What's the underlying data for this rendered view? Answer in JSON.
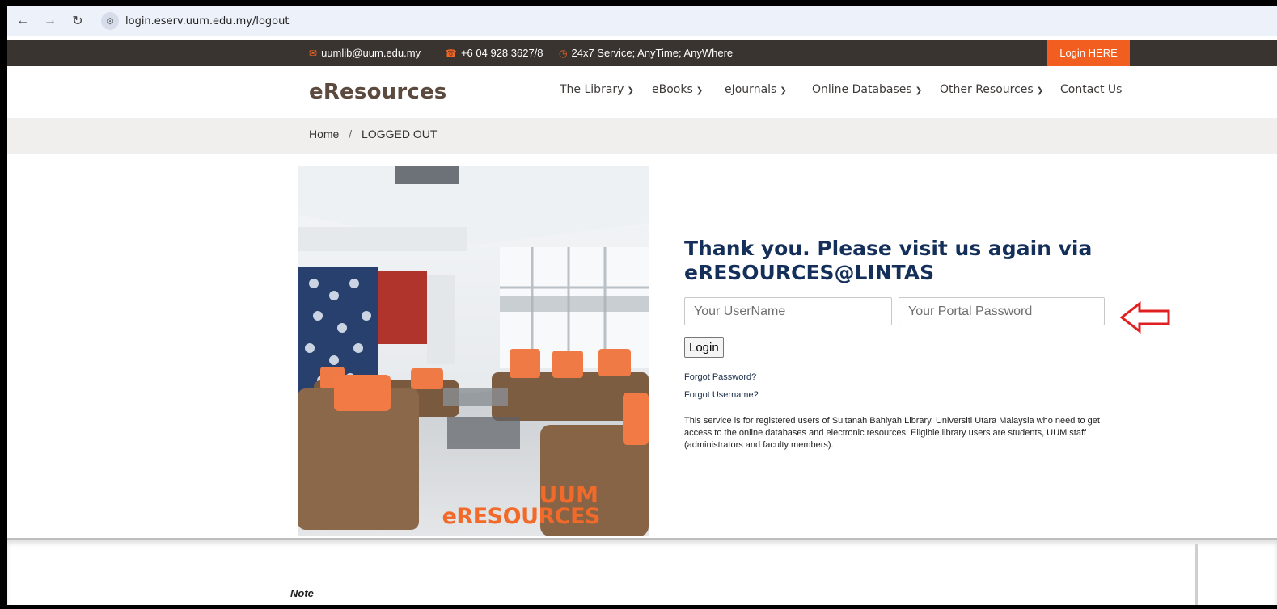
{
  "browser": {
    "back_icon": "arrow-left-icon",
    "forward_icon": "arrow-right-icon",
    "reload_icon": "reload-icon",
    "url": "login.eserv.uum.edu.my/logout"
  },
  "topbar": {
    "email": "uumlib@uum.edu.my",
    "phone": "+6 04 928 3627/8",
    "service": "24x7 Service; AnyTime; AnyWhere",
    "login_here": "Login HERE",
    "accent": "#f25e1f"
  },
  "header": {
    "brand": "eResources",
    "menu": [
      {
        "label": "The Library"
      },
      {
        "label": "eBooks"
      },
      {
        "label": "eJournals"
      },
      {
        "label": "Online Databases"
      },
      {
        "label": "Other Resources"
      },
      {
        "label": "Contact Us"
      }
    ]
  },
  "breadcrumb": {
    "home": "Home",
    "separator": "/",
    "current": "LOGGED OUT"
  },
  "photo": {
    "brand_line1": "UUM",
    "brand_line2": "eRESOURCES"
  },
  "login": {
    "title": "Thank you. Please visit us again via eRESOURCES@LINTAS",
    "username_placeholder": "Your UserName",
    "password_placeholder": "Your Portal Password",
    "button": "Login",
    "forgot_password": "Forgot Password?",
    "forgot_username": "Forgot Username?",
    "description": "This service is for registered users of Sultanah Bahiyah Library, Universiti Utara Malaysia who need to get access to the online databases and electronic resources. Eligible library users are students, UUM staff (administrators and faculty members).",
    "annotation_color": "#e02020"
  },
  "lower": {
    "note": "Note"
  }
}
